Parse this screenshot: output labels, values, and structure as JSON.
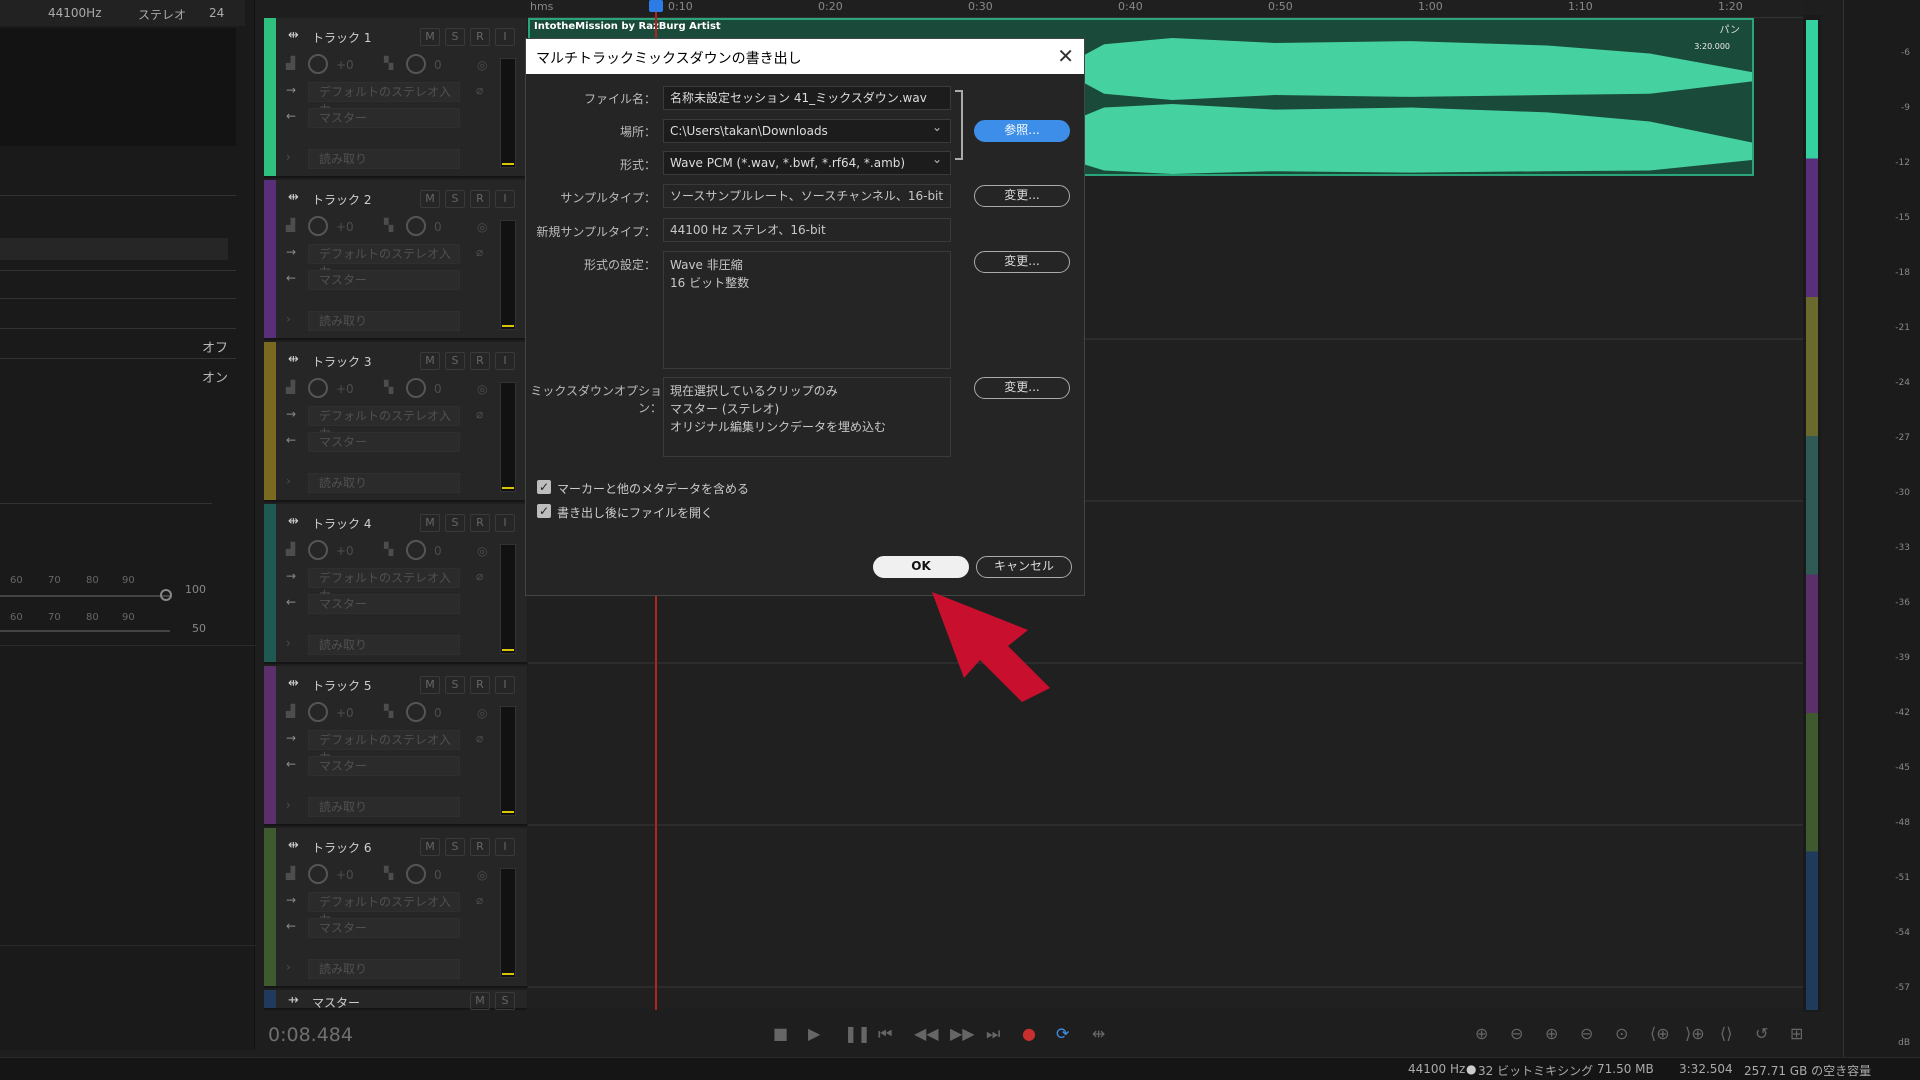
{
  "left_panel": {
    "header": {
      "rate": "44100Hz",
      "channels": "ステレオ",
      "bits": "24"
    },
    "off_label": "オフ",
    "on_label": "オン",
    "slider1": {
      "ticks": [
        "60",
        "70",
        "80",
        "90",
        "100"
      ]
    },
    "slider2": {
      "ticks": [
        "60",
        "70",
        "80",
        "90",
        "50"
      ]
    }
  },
  "tracks": [
    {
      "name": "トラック 1",
      "color": "#2fbf7f",
      "input": "デフォルトのステレオ入力",
      "output": "マスター",
      "mode": "読み取り",
      "vol": "+0",
      "pan": "0"
    },
    {
      "name": "トラック 2",
      "color": "#5a2f7a",
      "input": "デフォルトのステレオ入力",
      "output": "マスター",
      "mode": "読み取り",
      "vol": "+0",
      "pan": "0"
    },
    {
      "name": "トラック 3",
      "color": "#7a6a1f",
      "input": "デフォルトのステレオ入力",
      "output": "マスター",
      "mode": "読み取り",
      "vol": "+0",
      "pan": "0"
    },
    {
      "name": "トラック 4",
      "color": "#1f5a52",
      "input": "デフォルトのステレオ入力",
      "output": "マスター",
      "mode": "読み取り",
      "vol": "+0",
      "pan": "0"
    },
    {
      "name": "トラック 5",
      "color": "#5a2f6a",
      "input": "デフォルトのステレオ入力",
      "output": "マスター",
      "mode": "読み取り",
      "vol": "+0",
      "pan": "0"
    },
    {
      "name": "トラック 6",
      "color": "#3f5a2f",
      "input": "デフォルトのステレオ入力",
      "output": "マスター",
      "mode": "読み取り",
      "vol": "+0",
      "pan": "0"
    }
  ],
  "track_buttons": {
    "m": "M",
    "s": "S",
    "r": "R",
    "i": "I"
  },
  "master_track": {
    "name": "マスター",
    "m": "M",
    "s": "S"
  },
  "ruler": {
    "unit": "hms",
    "ticks": [
      "0:10",
      "0:20",
      "0:30",
      "0:40",
      "0:50",
      "1:00",
      "1:10",
      "1:20"
    ]
  },
  "clip": {
    "title": "IntotheMission by RazBurg Artist",
    "pan": "パン",
    "time": "3:20.000"
  },
  "db_scale": [
    "-6",
    "-9",
    "-12",
    "-15",
    "-18",
    "-21",
    "-24",
    "-27",
    "-30",
    "-33",
    "-36",
    "-39",
    "-42",
    "-45",
    "-48",
    "-51",
    "-54",
    "-57",
    "dB"
  ],
  "transport": {
    "time": "0:08.484"
  },
  "status": {
    "sample": "44100 Hz",
    "mix": "32 ビットミキシング",
    "size": "71.50 MB",
    "duration": "3:32.504",
    "free": "257.71 GB の空き容量"
  },
  "dialog": {
    "title": "マルチトラックミックスダウンの書き出し",
    "filename_label": "ファイル名：",
    "filename": "名称未設定セッション 41_ミックスダウン.wav",
    "location_label": "場所：",
    "location": "C:\\Users\\takan\\Downloads",
    "browse": "参照...",
    "format_label": "形式：",
    "format": "Wave PCM (*.wav, *.bwf, *.rf64, *.amb)",
    "sample_type_label": "サンプルタイプ：",
    "sample_type": "ソースサンプルレート、ソースチャンネル、16-bit",
    "change1": "変更...",
    "new_sample_type_label": "新規サンプルタイプ：",
    "new_sample_type": "44100 Hz ステレオ、16-bit",
    "format_settings_label": "形式の設定：",
    "format_settings": "Wave 非圧縮\n16 ビット整数",
    "change2": "変更...",
    "mixdown_label": "ミックスダウンオプション：",
    "mixdown_options": "現在選択しているクリップのみ\nマスター (ステレオ)\nオリジナル編集リンクデータを埋め込む",
    "change3": "変更...",
    "check1": "マーカーと他のメタデータを含める",
    "check2": "書き出し後にファイルを開く",
    "ok": "OK",
    "cancel": "キャンセル"
  },
  "accent_colors": {
    "arrow": "#c8102e",
    "clip": "#45d1a0",
    "browse": "#3d8ee8"
  }
}
